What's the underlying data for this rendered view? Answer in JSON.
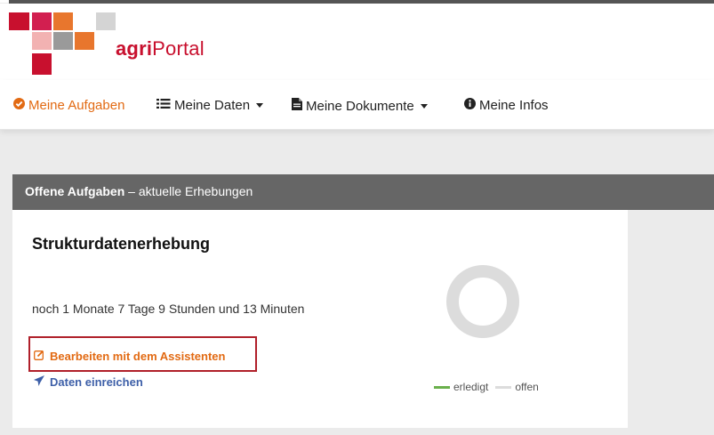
{
  "header": {
    "brand_prefix": "agri",
    "brand_suffix": "Portal",
    "logo_colors": [
      "#c8102e",
      "#e8762d",
      "#f0a0a0",
      "#9a9a9a",
      "#d0d0d0",
      "#c8102e"
    ]
  },
  "nav": {
    "items": [
      {
        "label": "Meine Aufgaben",
        "icon": "check-circle-icon",
        "active": true
      },
      {
        "label": "Meine Daten",
        "icon": "list-icon",
        "dropdown": true
      },
      {
        "label": "Meine Dokumente",
        "icon": "file-icon",
        "dropdown": true
      },
      {
        "label": "Meine Infos",
        "icon": "info-circle-icon"
      }
    ]
  },
  "panel": {
    "title_bold": "Offene Aufgaben",
    "title_rest": " – aktuelle Erhebungen"
  },
  "task": {
    "title": "Strukturdatenerhebung",
    "countdown": "noch 1 Monate 7 Tage 9 Stunden und 13 Minuten",
    "edit_link": "Bearbeiten mit dem Assistenten",
    "edit_icon": "edit-icon",
    "submit_link": "Daten einreichen",
    "submit_icon": "paper-plane-icon"
  },
  "chart_data": {
    "type": "pie",
    "categories": [
      "erledigt",
      "offen"
    ],
    "values": [
      0,
      100
    ],
    "colors": [
      "#6ab04c",
      "#dcdcdc"
    ],
    "legend": [
      "erledigt",
      "offen"
    ],
    "title": ""
  },
  "colors": {
    "accent_orange": "#e26a13",
    "link_blue": "#3d5fa8",
    "panel_gray": "#666666",
    "highlight_red": "#b0202a"
  }
}
